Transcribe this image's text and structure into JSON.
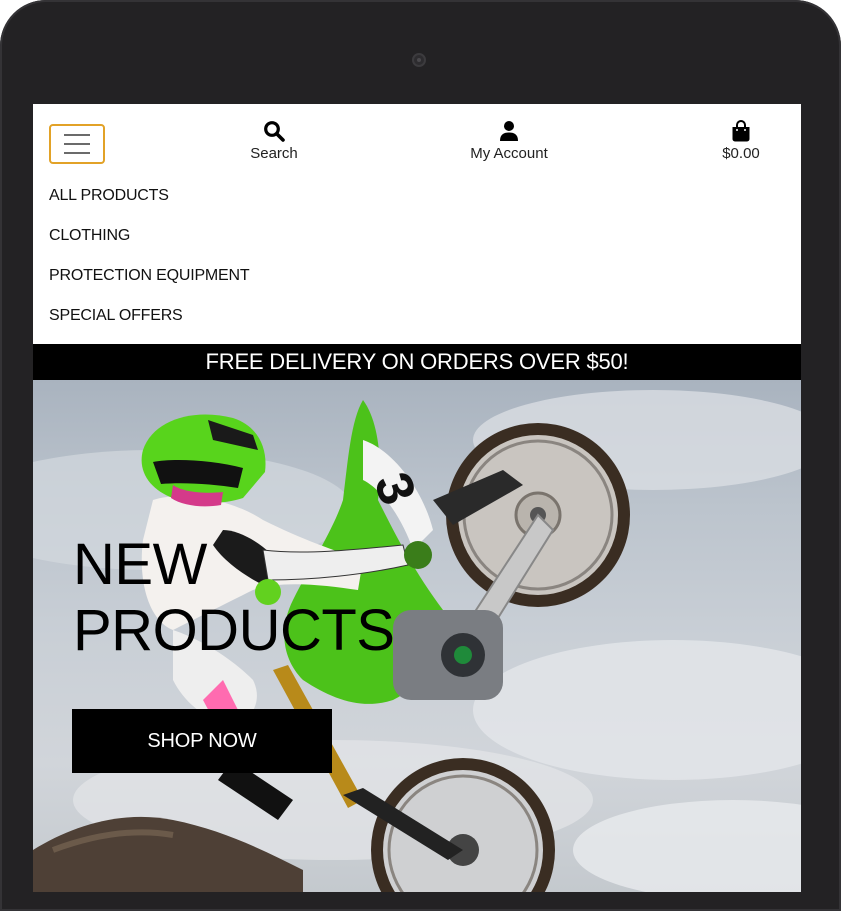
{
  "header": {
    "menu_toggle_label": "",
    "search_label": "Search",
    "account_label": "My Account",
    "bag_total": "$0.00"
  },
  "nav": {
    "items": [
      {
        "label": "ALL PRODUCTS"
      },
      {
        "label": "CLOTHING"
      },
      {
        "label": "PROTECTION EQUIPMENT"
      },
      {
        "label": "SPECIAL OFFERS"
      }
    ]
  },
  "banner": {
    "text": "FREE DELIVERY ON ORDERS OVER $50!"
  },
  "hero": {
    "title_line1": "NEW",
    "title_line2": "PRODUCTS",
    "cta_label": "SHOP NOW",
    "image_subject": "motocross rider on a green dirt bike mid-jump"
  },
  "colors": {
    "device_frame": "#232224",
    "toggle_border": "#e2a227",
    "banner_bg": "#000000",
    "banner_text": "#ffffff",
    "cta_bg": "#000000",
    "bike_green": "#4cc21a"
  },
  "icons": {
    "search": "search-icon",
    "account": "user-icon",
    "bag": "shopping-bag-icon",
    "menu": "hamburger-menu-icon"
  }
}
